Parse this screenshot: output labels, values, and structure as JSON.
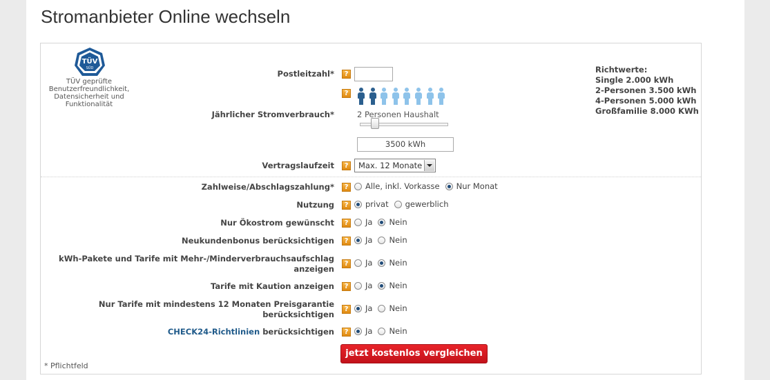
{
  "page": {
    "title": "Stromanbieter Online wechseln"
  },
  "certificate": {
    "logo_text": "TÜV",
    "logo_sub": "SÜD",
    "text": "TÜV geprüfte Benutzerfreundlichkeit, Datensicherheit und Funktionalität",
    "logo_icon": "tuv-seal-icon"
  },
  "form": {
    "postleitzahl": {
      "label": "Postleitzahl*",
      "value": ""
    },
    "verbrauch": {
      "label": "Jährlicher Stromverbrauch*",
      "persons_total": 8,
      "persons_selected": 2,
      "household_label": "2 Personen Haushalt",
      "slider_fraction": 0.14,
      "value": "3500 kWh"
    },
    "vertragslaufzeit": {
      "label": "Vertragslaufzeit",
      "selected": "Max. 12 Monate"
    },
    "questions": [
      {
        "label": "Zahlweise/Abschlagszahlung*",
        "options": [
          "Alle, inkl. Vorkasse",
          "Nur Monat"
        ],
        "selected": 1
      },
      {
        "label": "Nutzung",
        "options": [
          "privat",
          "gewerblich"
        ],
        "selected": 0
      },
      {
        "label": "Nur Ökostrom gewünscht",
        "options": [
          "Ja",
          "Nein"
        ],
        "selected": 1
      },
      {
        "label": "Neukundenbonus berücksichtigen",
        "options": [
          "Ja",
          "Nein"
        ],
        "selected": 0
      },
      {
        "label": "kWh-Pakete und Tarife mit Mehr-/Minderverbrauchsaufschlag anzeigen",
        "options": [
          "Ja",
          "Nein"
        ],
        "selected": 1
      },
      {
        "label": "Tarife mit Kaution anzeigen",
        "options": [
          "Ja",
          "Nein"
        ],
        "selected": 1
      },
      {
        "label": "Nur Tarife mit mindestens 12 Monaten Preisgarantie berücksichtigen",
        "options": [
          "Ja",
          "Nein"
        ],
        "selected": 0
      },
      {
        "label_link": "CHECK24-Richtlinien",
        "label_rest": " berücksichtigen",
        "options": [
          "Ja",
          "Nein"
        ],
        "selected": 0
      }
    ],
    "help_glyph": "?",
    "submit_label": "jetzt kostenlos vergleichen",
    "required_note": "* Pflichtfeld"
  },
  "richtwerte": {
    "title": "Richtwerte:",
    "items": [
      "Single 2.000 kWh",
      "2-Personen 3.500 kWh",
      "4-Personen 5.000 kWh",
      "Großfamilie 8.000 KWh"
    ]
  },
  "colors": {
    "accent_red": "#d71920",
    "help_orange": "#f0a030",
    "person_selected": "#2b5f8e",
    "person_unselected": "#8ec3ea",
    "link_blue": "#1f5a8a"
  }
}
